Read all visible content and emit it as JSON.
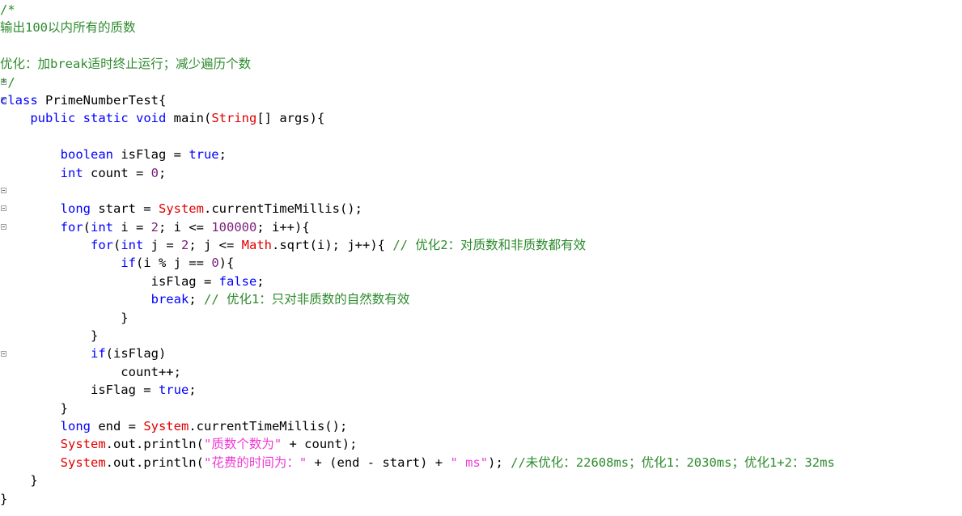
{
  "editor": {
    "language": "java",
    "file_kind": "source-code",
    "colors": {
      "background": "#ffffff",
      "text": "#000000",
      "comment": "#2e8b2e",
      "keyword": "#0000ff",
      "class_name": "#e00000",
      "string": "#ef3ad4",
      "number": "#7a1f7a",
      "gutter_marker_border": "#9aa0a6"
    },
    "gutter": {
      "marker_name": "code-fold-marker",
      "marker_lines": [
        5,
        6,
        11,
        12,
        13,
        20
      ]
    }
  },
  "lines": [
    {
      "n": 1,
      "tokens": [
        {
          "t": "/*",
          "c": "cmt"
        }
      ]
    },
    {
      "n": 2,
      "tokens": [
        {
          "t": "输出100以内所有的质数",
          "c": "cmt"
        }
      ]
    },
    {
      "n": 3,
      "tokens": [
        {
          "t": "",
          "c": "cmt"
        }
      ]
    },
    {
      "n": 4,
      "tokens": [
        {
          "t": "优化：加break适时终止运行；减少遍历个数",
          "c": "cmt"
        }
      ]
    },
    {
      "n": 5,
      "tokens": [
        {
          "t": "*/",
          "c": "cmt"
        }
      ]
    },
    {
      "n": 6,
      "tokens": [
        {
          "t": "class",
          "c": "kw"
        },
        {
          "t": " PrimeNumberTest{",
          "c": "plain"
        }
      ]
    },
    {
      "n": 7,
      "tokens": [
        {
          "t": "    ",
          "c": "plain"
        },
        {
          "t": "public",
          "c": "kw"
        },
        {
          "t": " ",
          "c": "plain"
        },
        {
          "t": "static",
          "c": "kw"
        },
        {
          "t": " ",
          "c": "plain"
        },
        {
          "t": "void",
          "c": "kw"
        },
        {
          "t": " main(",
          "c": "plain"
        },
        {
          "t": "String",
          "c": "cls"
        },
        {
          "t": "[] args){",
          "c": "plain"
        }
      ]
    },
    {
      "n": 8,
      "tokens": [
        {
          "t": "",
          "c": "plain"
        }
      ]
    },
    {
      "n": 9,
      "tokens": [
        {
          "t": "        ",
          "c": "plain"
        },
        {
          "t": "boolean",
          "c": "kw"
        },
        {
          "t": " isFlag = ",
          "c": "plain"
        },
        {
          "t": "true",
          "c": "kw"
        },
        {
          "t": ";",
          "c": "plain"
        }
      ]
    },
    {
      "n": 10,
      "tokens": [
        {
          "t": "        ",
          "c": "plain"
        },
        {
          "t": "int",
          "c": "kw"
        },
        {
          "t": " count = ",
          "c": "plain"
        },
        {
          "t": "0",
          "c": "num"
        },
        {
          "t": ";",
          "c": "plain"
        }
      ]
    },
    {
      "n": 11,
      "tokens": [
        {
          "t": "",
          "c": "plain"
        }
      ]
    },
    {
      "n": 12,
      "tokens": [
        {
          "t": "        ",
          "c": "plain"
        },
        {
          "t": "long",
          "c": "kw"
        },
        {
          "t": " start = ",
          "c": "plain"
        },
        {
          "t": "System",
          "c": "cls"
        },
        {
          "t": ".currentTimeMillis();",
          "c": "plain"
        }
      ]
    },
    {
      "n": 13,
      "tokens": [
        {
          "t": "        ",
          "c": "plain"
        },
        {
          "t": "for",
          "c": "kw"
        },
        {
          "t": "(",
          "c": "plain"
        },
        {
          "t": "int",
          "c": "kw"
        },
        {
          "t": " i = ",
          "c": "plain"
        },
        {
          "t": "2",
          "c": "num"
        },
        {
          "t": "; i <= ",
          "c": "plain"
        },
        {
          "t": "100000",
          "c": "num"
        },
        {
          "t": "; i++){",
          "c": "plain"
        }
      ]
    },
    {
      "n": 14,
      "tokens": [
        {
          "t": "            ",
          "c": "plain"
        },
        {
          "t": "for",
          "c": "kw"
        },
        {
          "t": "(",
          "c": "plain"
        },
        {
          "t": "int",
          "c": "kw"
        },
        {
          "t": " j = ",
          "c": "plain"
        },
        {
          "t": "2",
          "c": "num"
        },
        {
          "t": "; j <= ",
          "c": "plain"
        },
        {
          "t": "Math",
          "c": "cls"
        },
        {
          "t": ".sqrt(i); j++){ ",
          "c": "plain"
        },
        {
          "t": "// 优化2：对质数和非质数都有效",
          "c": "cmt"
        }
      ]
    },
    {
      "n": 15,
      "tokens": [
        {
          "t": "                ",
          "c": "plain"
        },
        {
          "t": "if",
          "c": "kw"
        },
        {
          "t": "(i % j == ",
          "c": "plain"
        },
        {
          "t": "0",
          "c": "num"
        },
        {
          "t": "){",
          "c": "plain"
        }
      ]
    },
    {
      "n": 16,
      "tokens": [
        {
          "t": "                    isFlag = ",
          "c": "plain"
        },
        {
          "t": "false",
          "c": "kw"
        },
        {
          "t": ";",
          "c": "plain"
        }
      ]
    },
    {
      "n": 17,
      "tokens": [
        {
          "t": "                    ",
          "c": "plain"
        },
        {
          "t": "break",
          "c": "kw"
        },
        {
          "t": "; ",
          "c": "plain"
        },
        {
          "t": "// 优化1：只对非质数的自然数有效",
          "c": "cmt"
        }
      ]
    },
    {
      "n": 18,
      "tokens": [
        {
          "t": "                }",
          "c": "plain"
        }
      ]
    },
    {
      "n": 19,
      "tokens": [
        {
          "t": "            }",
          "c": "plain"
        }
      ]
    },
    {
      "n": 20,
      "tokens": [
        {
          "t": "            ",
          "c": "plain"
        },
        {
          "t": "if",
          "c": "kw"
        },
        {
          "t": "(isFlag)",
          "c": "plain"
        }
      ]
    },
    {
      "n": 21,
      "tokens": [
        {
          "t": "                count++;",
          "c": "plain"
        }
      ]
    },
    {
      "n": 22,
      "tokens": [
        {
          "t": "            isFlag = ",
          "c": "plain"
        },
        {
          "t": "true",
          "c": "kw"
        },
        {
          "t": ";",
          "c": "plain"
        }
      ]
    },
    {
      "n": 23,
      "tokens": [
        {
          "t": "        }",
          "c": "plain"
        }
      ]
    },
    {
      "n": 24,
      "tokens": [
        {
          "t": "        ",
          "c": "plain"
        },
        {
          "t": "long",
          "c": "kw"
        },
        {
          "t": " end = ",
          "c": "plain"
        },
        {
          "t": "System",
          "c": "cls"
        },
        {
          "t": ".currentTimeMillis();",
          "c": "plain"
        }
      ]
    },
    {
      "n": 25,
      "tokens": [
        {
          "t": "        ",
          "c": "plain"
        },
        {
          "t": "System",
          "c": "cls"
        },
        {
          "t": ".out.println(",
          "c": "plain"
        },
        {
          "t": "\"质数个数为\"",
          "c": "str"
        },
        {
          "t": " + count);",
          "c": "plain"
        }
      ]
    },
    {
      "n": 26,
      "tokens": [
        {
          "t": "        ",
          "c": "plain"
        },
        {
          "t": "System",
          "c": "cls"
        },
        {
          "t": ".out.println(",
          "c": "plain"
        },
        {
          "t": "\"花费的时间为：\"",
          "c": "str"
        },
        {
          "t": " + (end - start) + ",
          "c": "plain"
        },
        {
          "t": "\" ms\"",
          "c": "str"
        },
        {
          "t": "); ",
          "c": "plain"
        },
        {
          "t": "//未优化：22608ms；优化1：2030ms；优化1+2：32ms",
          "c": "cmt"
        }
      ]
    },
    {
      "n": 27,
      "tokens": [
        {
          "t": "    }",
          "c": "plain"
        }
      ]
    },
    {
      "n": 28,
      "tokens": [
        {
          "t": "}",
          "c": "plain"
        }
      ]
    }
  ],
  "benchmarks": {
    "unoptimized_ms": "22608ms",
    "optimization_1_ms": "2030ms",
    "optimization_1_plus_2_ms": "32ms"
  }
}
